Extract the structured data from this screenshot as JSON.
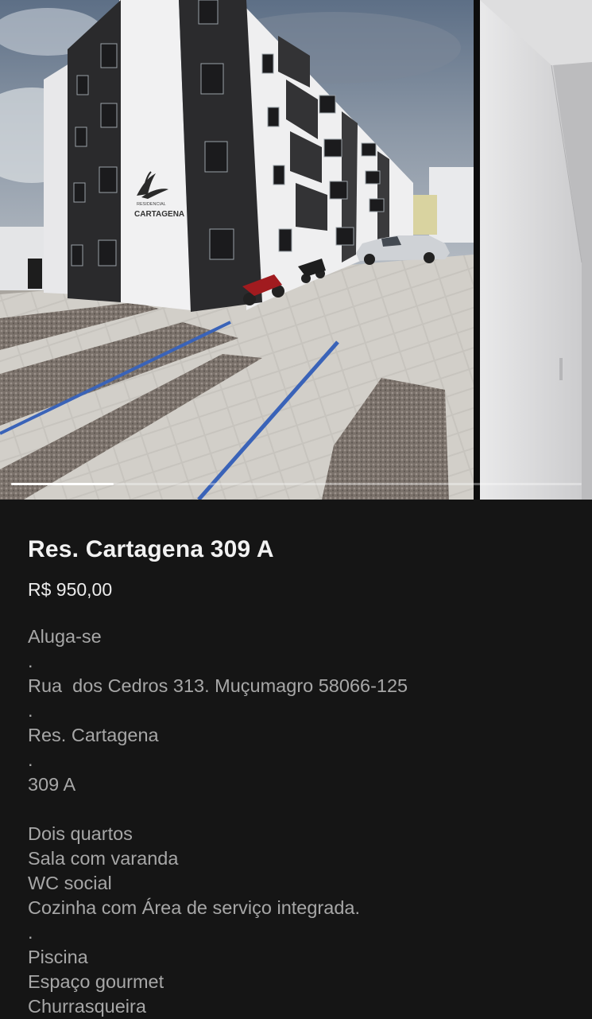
{
  "gallery": {
    "current_index": 1,
    "total_images": 5,
    "progress_fraction": 0.18,
    "photo_main_alt": "building-exterior-photo",
    "photo_next_alt": "interior-wall-photo",
    "facade_sign": {
      "small_text": "RESIDENCIAL",
      "name_text": "CARTAGENA"
    }
  },
  "listing": {
    "title": "Res. Cartagena 309 A",
    "price": "R$ 950,00",
    "description_lines": [
      "Aluga-se",
      ".",
      "Rua  dos Cedros 313. Muçumagro 58066-125",
      ".",
      "Res. Cartagena",
      ".",
      "309 A",
      "",
      "Dois quartos",
      "Sala com varanda",
      "WC social",
      "Cozinha com Área de serviço integrada.",
      ".",
      "Piscina",
      "Espaço gourmet",
      "Churrasqueira"
    ]
  },
  "colors": {
    "background": "#151515",
    "title": "#f2f2f2",
    "body_text": "#a7a7a7",
    "progress_fill": "#ffffff"
  }
}
